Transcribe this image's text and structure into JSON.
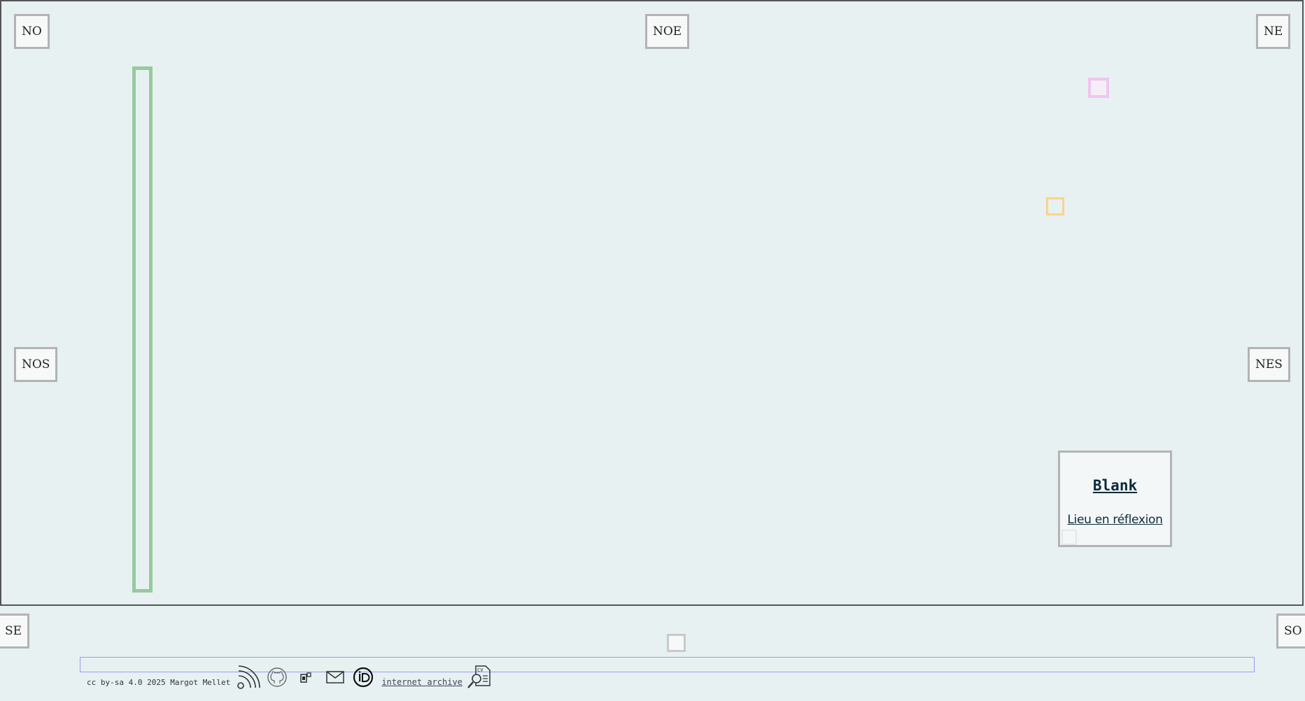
{
  "corners": {
    "no": "NO",
    "noe": "NOE",
    "ne": "NE",
    "nos": "NOS",
    "nes": "NES",
    "se": "SE",
    "so": "SO"
  },
  "card": {
    "title": "Blank",
    "subtitle": "Lieu en réflexion"
  },
  "footer": {
    "copyright": "cc by-sa 4.0 2025 Margot Mellet",
    "archive_link": "internet archive",
    "icons": [
      "rss-icon",
      "github-icon",
      "zotero-icon",
      "mail-icon",
      "orcid-icon",
      "cv-icon"
    ]
  },
  "colors": {
    "background": "#e7f1f2",
    "green_bar": "#98c99d",
    "pink_square": "#f0c5ee",
    "orange_square": "#fbd388",
    "footer_strip": "#9a9af2"
  }
}
